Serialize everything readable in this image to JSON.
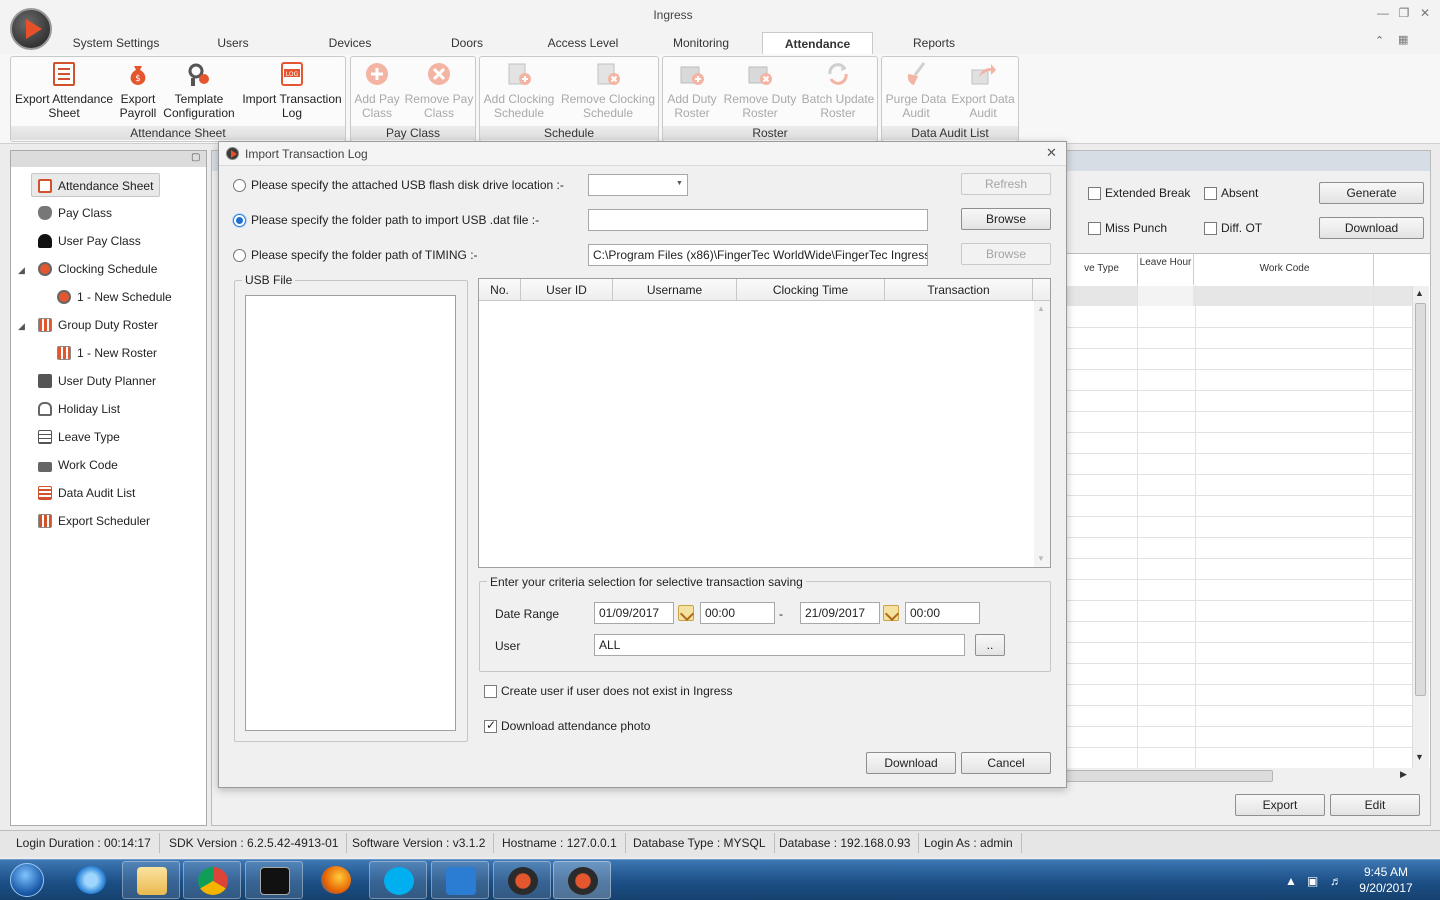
{
  "app": {
    "title": "Ingress"
  },
  "tabs": [
    {
      "label": "System Settings"
    },
    {
      "label": "Users"
    },
    {
      "label": "Devices"
    },
    {
      "label": "Doors"
    },
    {
      "label": "Access Level"
    },
    {
      "label": "Monitoring"
    },
    {
      "label": "Attendance",
      "active": true
    },
    {
      "label": "Reports"
    }
  ],
  "ribbon": {
    "groups": [
      {
        "label": "Attendance Sheet"
      },
      {
        "label": "Pay Class"
      },
      {
        "label": "Schedule"
      },
      {
        "label": "Roster"
      },
      {
        "label": "Data Audit List"
      }
    ],
    "buttons": [
      {
        "label": "Export Attendance Sheet",
        "icon": "attendance-sheet-icon",
        "enabled": true
      },
      {
        "label": "Export Payroll",
        "icon": "money-bag-icon",
        "enabled": true
      },
      {
        "label": "Template Configuration",
        "icon": "template-config-icon",
        "enabled": true
      },
      {
        "label": "Import Transaction Log",
        "icon": "log-icon",
        "enabled": true
      },
      {
        "label": "Add Pay Class",
        "icon": "add-icon",
        "enabled": false
      },
      {
        "label": "Remove Pay Class",
        "icon": "remove-icon",
        "enabled": false
      },
      {
        "label": "Add Clocking Schedule",
        "icon": "add-schedule-icon",
        "enabled": false
      },
      {
        "label": "Remove Clocking Schedule",
        "icon": "remove-schedule-icon",
        "enabled": false
      },
      {
        "label": "Add Duty Roster",
        "icon": "add-roster-icon",
        "enabled": false
      },
      {
        "label": "Remove Duty Roster",
        "icon": "remove-roster-icon",
        "enabled": false
      },
      {
        "label": "Batch Update Roster",
        "icon": "refresh-icon",
        "enabled": false
      },
      {
        "label": "Purge Data Audit",
        "icon": "broom-icon",
        "enabled": false
      },
      {
        "label": "Export Data Audit",
        "icon": "export-icon",
        "enabled": false
      }
    ]
  },
  "sidebar": {
    "items": [
      {
        "label": "Attendance Sheet",
        "icon": "attendance-sheet-icon",
        "selected": true
      },
      {
        "label": "Pay Class",
        "icon": "money-bag-icon"
      },
      {
        "label": "User Pay Class",
        "icon": "user-icon"
      },
      {
        "label": "Clocking Schedule",
        "icon": "clock-icon",
        "expanded": true
      },
      {
        "label": "1 - New Schedule",
        "icon": "clock-icon"
      },
      {
        "label": "Group Duty Roster",
        "icon": "calendar-icon",
        "expanded": true
      },
      {
        "label": "1 - New Roster",
        "icon": "calendar-icon"
      },
      {
        "label": "User Duty Planner",
        "icon": "briefcase-icon"
      },
      {
        "label": "Holiday List",
        "icon": "holiday-icon"
      },
      {
        "label": "Leave Type",
        "icon": "grid-icon"
      },
      {
        "label": "Work Code",
        "icon": "monitor-icon"
      },
      {
        "label": "Data Audit List",
        "icon": "list-icon"
      },
      {
        "label": "Export Scheduler",
        "icon": "schedule-export-icon"
      }
    ]
  },
  "main": {
    "options": [
      {
        "label": "Extended Break",
        "checked": false
      },
      {
        "label": "Absent",
        "checked": false
      },
      {
        "label": "Miss Punch",
        "checked": false
      },
      {
        "label": "Diff. OT",
        "checked": false
      }
    ],
    "generate_label": "Generate",
    "download_label": "Download",
    "grid_columns": [
      "ve Type",
      "Leave Hour",
      "Work Code"
    ],
    "export_label": "Export",
    "edit_label": "Edit"
  },
  "dialog": {
    "title": "Import Transaction Log",
    "options": [
      {
        "label": "Please specify the attached USB flash disk drive location :-",
        "selected": false
      },
      {
        "label": "Please specify the folder path to import USB .dat file :-",
        "selected": true
      },
      {
        "label": "Please specify the folder path of TIMING :-",
        "selected": false
      }
    ],
    "usb_drive_value": "",
    "dat_path_value": "",
    "timing_path_value": "C:\\Program Files (x86)\\FingerTec WorldWide\\FingerTec Ingress\\",
    "refresh_label": "Refresh",
    "browse_label": "Browse",
    "usb_file_title": "USB File",
    "columns": [
      "No.",
      "User ID",
      "Username",
      "Clocking Time",
      "Transaction"
    ],
    "criteria_title": "Enter your criteria selection for selective transaction saving",
    "date_range_label": "Date Range",
    "date_from": "01/09/2017",
    "time_from": "00:00",
    "date_sep": "-",
    "date_to": "21/09/2017",
    "time_to": "00:00",
    "user_label": "User",
    "user_value": "ALL",
    "user_picker_label": "..",
    "create_user_label": "Create user if user does not exist in Ingress",
    "create_user_checked": false,
    "download_photo_label": "Download attendance photo",
    "download_photo_checked": true,
    "download_label": "Download",
    "cancel_label": "Cancel"
  },
  "status": [
    "Login Duration : 00:14:17",
    "SDK Version : 6.2.5.42-4913-01",
    "Software Version : v3.1.2",
    "Hostname : 127.0.0.1",
    "Database Type : MYSQL",
    "Database : 192.168.0.93",
    "Login As : admin"
  ],
  "taskbar": {
    "apps": [
      {
        "icon": "internet-explorer-icon"
      },
      {
        "icon": "file-explorer-icon"
      },
      {
        "icon": "chrome-icon"
      },
      {
        "icon": "command-prompt-icon"
      },
      {
        "icon": "firefox-icon"
      },
      {
        "icon": "skype-icon"
      },
      {
        "icon": "word-icon"
      },
      {
        "icon": "ingress-icon"
      },
      {
        "icon": "ingress-icon"
      }
    ],
    "time": "9:45 AM",
    "date": "9/20/2017"
  }
}
